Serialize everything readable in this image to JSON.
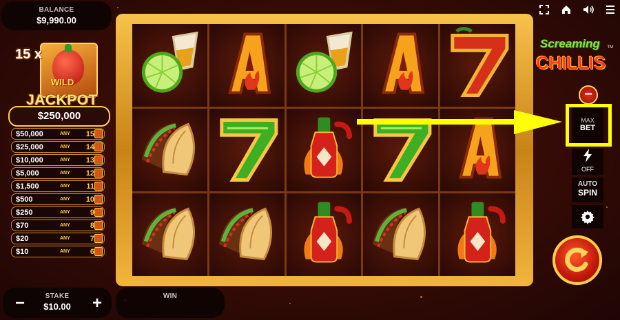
{
  "balance": {
    "label": "BALANCE",
    "value": "$9,990.00"
  },
  "jackpot": {
    "multiplier": "15 x",
    "wild_label": "WILD",
    "title": "JACKPOT",
    "total": "$250,000",
    "tiers": [
      {
        "amount": "$50,000",
        "any": "ANY",
        "count": "15"
      },
      {
        "amount": "$25,000",
        "any": "ANY",
        "count": "14"
      },
      {
        "amount": "$10,000",
        "any": "ANY",
        "count": "13"
      },
      {
        "amount": "$5,000",
        "any": "ANY",
        "count": "12"
      },
      {
        "amount": "$1,500",
        "any": "ANY",
        "count": "11"
      },
      {
        "amount": "$500",
        "any": "ANY",
        "count": "10"
      },
      {
        "amount": "$250",
        "any": "ANY",
        "count": "9"
      },
      {
        "amount": "$70",
        "any": "ANY",
        "count": "8"
      },
      {
        "amount": "$20",
        "any": "ANY",
        "count": "7"
      },
      {
        "amount": "$10",
        "any": "ANY",
        "count": "6"
      }
    ]
  },
  "stake": {
    "label": "STAKE",
    "value": "$10.00",
    "minus": "−",
    "plus": "+"
  },
  "win": {
    "label": "WIN"
  },
  "reels": [
    [
      "lime-tequila",
      "ace",
      "lime-tequila",
      "ace",
      "seven-red"
    ],
    [
      "taco",
      "seven-green",
      "hot-sauce",
      "seven-green",
      "ace"
    ],
    [
      "taco",
      "taco",
      "hot-sauce",
      "taco",
      "hot-sauce"
    ]
  ],
  "logo": {
    "line1": "Screaming",
    "line2": "CHILLIS",
    "tm": "TM"
  },
  "controls": {
    "minus": "−",
    "max_bet_line1": "MAX",
    "max_bet_line2": "BET",
    "turbo_label": "OFF",
    "auto_line1": "AUTO",
    "auto_line2": "SPIN"
  },
  "colors": {
    "highlight": "#ffff00",
    "gold": "#ffcf4a",
    "spin_red": "#c2180a"
  }
}
